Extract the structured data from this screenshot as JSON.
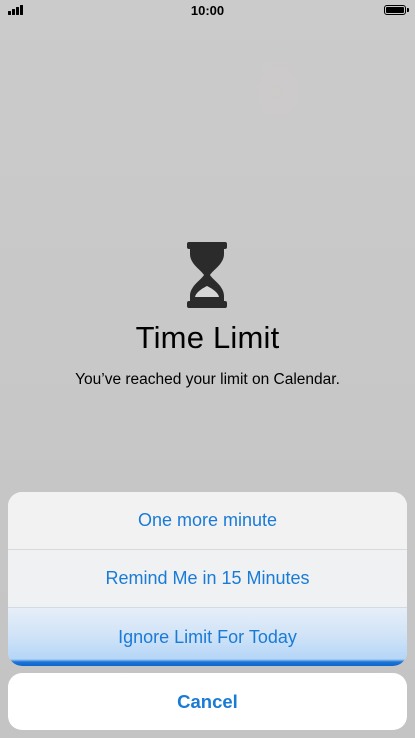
{
  "status_bar": {
    "time": "10:00"
  },
  "alert": {
    "icon": "hourglass-icon",
    "title": "Time Limit",
    "message": "You’ve reached your limit on Calendar."
  },
  "actions": [
    {
      "label": "One more minute"
    },
    {
      "label": "Remind Me in 15 Minutes"
    },
    {
      "label": "Ignore Limit For Today"
    }
  ],
  "cancel": {
    "label": "Cancel"
  },
  "colors": {
    "accent": "#1a7bd6",
    "background": "#c7c7c7"
  }
}
